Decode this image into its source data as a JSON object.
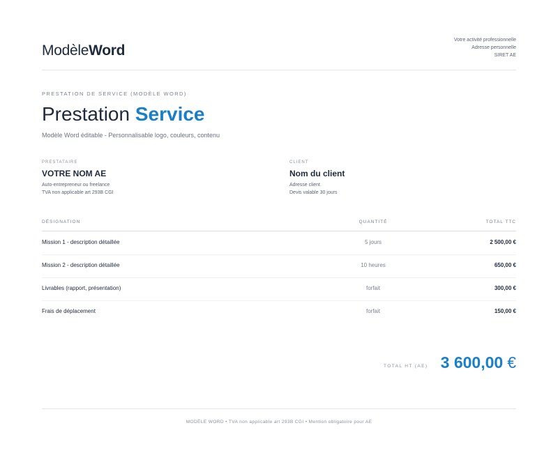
{
  "header": {
    "logo_light": "Modèle",
    "logo_bold": "Word",
    "issuer_lines": [
      "Votre activité professionnelle",
      "Adresse personnelle",
      "SIRET AE"
    ]
  },
  "title_block": {
    "kicker": "PRESTATION DE SERVICE (MODÈLE WORD)",
    "title_main": "Prestation",
    "title_accent": "Service",
    "subtitle": "Modèle Word éditable - Personnalisable logo, couleurs, contenu"
  },
  "provider": {
    "label": "PRESTATAIRE",
    "name": "VOTRE NOM AE",
    "lines": [
      "Auto-entrepreneur ou freelance",
      "TVA non applicable art 293B CGI"
    ]
  },
  "client": {
    "label": "CLIENT",
    "name": "Nom du client",
    "lines": [
      "Adresse client",
      "Devis valable 30 jours"
    ]
  },
  "table": {
    "headers": {
      "designation": "DÉSIGNATION",
      "quantity": "QUANTITÉ",
      "total": "TOTAL TTC"
    },
    "rows": [
      {
        "designation": "Mission 1 - description détaillée",
        "quantity": "5 jours",
        "total": "2 500,00 €"
      },
      {
        "designation": "Mission 2 - description détaillée",
        "quantity": "10 heures",
        "total": "650,00 €"
      },
      {
        "designation": "Livrables (rapport, présentation)",
        "quantity": "forfait",
        "total": "300,00 €"
      },
      {
        "designation": "Frais de déplacement",
        "quantity": "forfait",
        "total": "150,00 €"
      }
    ]
  },
  "totals": {
    "label": "TOTAL HT (AE)",
    "amount": "3 600,00",
    "currency": "€"
  },
  "footer": {
    "text": "MODÈLE WORD • TVA non applicable art 293B CGI • Mention obligatoire pour AE"
  },
  "colors": {
    "accent": "#1a7fc8",
    "text": "#1f2a3d",
    "muted": "#7a8190"
  }
}
